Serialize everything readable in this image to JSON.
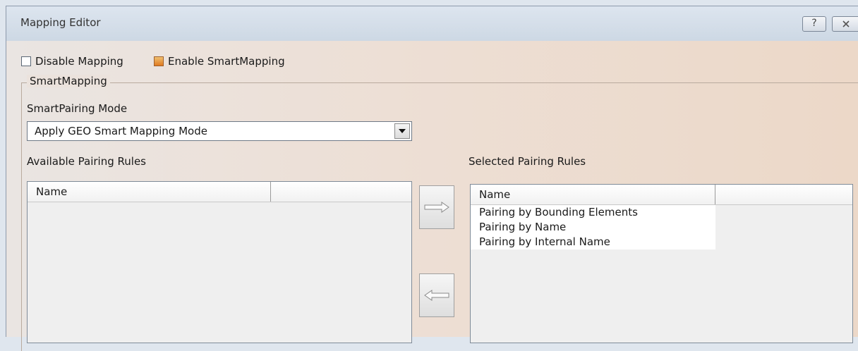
{
  "window": {
    "title": "Mapping Editor",
    "help_label": "?",
    "close_label": "X"
  },
  "options": {
    "disable_mapping": {
      "label": "Disable Mapping",
      "checked": false
    },
    "enable_smartmapping": {
      "label": "Enable SmartMapping",
      "checked": true
    }
  },
  "smartmapping": {
    "group_label": "SmartMapping",
    "mode_label": "SmartPairing Mode",
    "mode_value": "Apply GEO Smart Mapping Mode"
  },
  "available": {
    "label": "Available Pairing Rules",
    "columns": [
      "Name",
      ""
    ],
    "rows": []
  },
  "selected": {
    "label": "Selected Pairing Rules",
    "columns": [
      "Name",
      ""
    ],
    "rows": [
      "Pairing by Bounding Elements",
      "Pairing by Name",
      "Pairing by Internal Name"
    ]
  },
  "icons": {
    "add": "arrow-right-icon",
    "remove": "arrow-left-icon",
    "dropdown": "chevron-down-icon"
  }
}
